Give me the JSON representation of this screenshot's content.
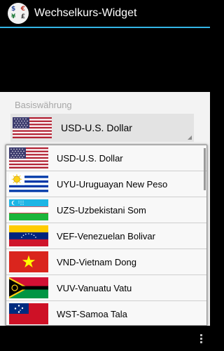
{
  "app": {
    "title": "Wechselkurs-Widget",
    "icon": "app-currency-icon",
    "icon_letters": [
      "$",
      "€",
      "¥",
      "£"
    ],
    "accent_color": "#33b5e5"
  },
  "base_currency": {
    "label": "Basiswährung",
    "selected": "USD-U.S. Dollar",
    "selected_flag": "flag-usa-icon"
  },
  "dropdown": {
    "items": [
      {
        "label": "USD-U.S. Dollar",
        "flag": "flag-usa-icon"
      },
      {
        "label": "UYU-Uruguayan New Peso",
        "flag": "flag-uruguay-icon"
      },
      {
        "label": "UZS-Uzbekistani Som",
        "flag": "flag-uzbekistan-icon"
      },
      {
        "label": "VEF-Venezuelan Bolivar",
        "flag": "flag-venezuela-icon"
      },
      {
        "label": "VND-Vietnam Dong",
        "flag": "flag-vietnam-icon"
      },
      {
        "label": "VUV-Vanuatu Vatu",
        "flag": "flag-vanuatu-icon"
      },
      {
        "label": "WST-Samoa Tala",
        "flag": "flag-samoa-icon"
      }
    ]
  }
}
